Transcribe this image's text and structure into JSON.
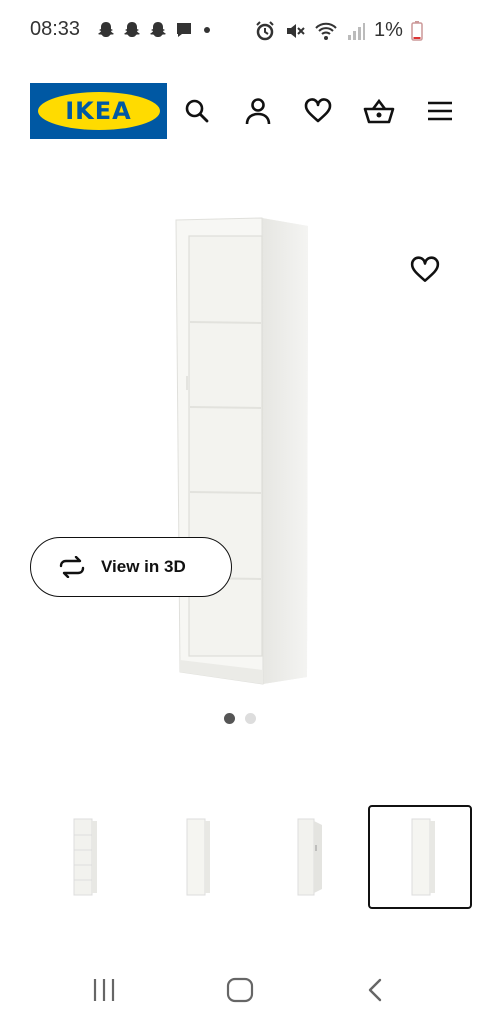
{
  "status_bar": {
    "time": "08:33",
    "battery_percent": "1%",
    "left_icons": [
      "snapchat-icon",
      "snapchat-icon",
      "snapchat-icon",
      "message-icon",
      "dot-icon"
    ],
    "right_icons": [
      "alarm-icon",
      "mute-icon",
      "wifi-icon",
      "signal-icon",
      "battery-icon"
    ]
  },
  "header": {
    "logo_text": "IKEA",
    "logo_colors": {
      "blue": "#0058a3",
      "yellow": "#ffdb00"
    },
    "icons": [
      "search-icon",
      "account-icon",
      "heart-icon",
      "basket-icon",
      "menu-icon"
    ]
  },
  "product_gallery": {
    "view_3d_label": "View in 3D",
    "image_index": 1,
    "image_count": 2,
    "thumbnail_count": 4,
    "selected_thumbnail": 4
  },
  "nav_bar": {
    "icons": [
      "recent-apps-icon",
      "home-icon",
      "back-icon"
    ]
  }
}
